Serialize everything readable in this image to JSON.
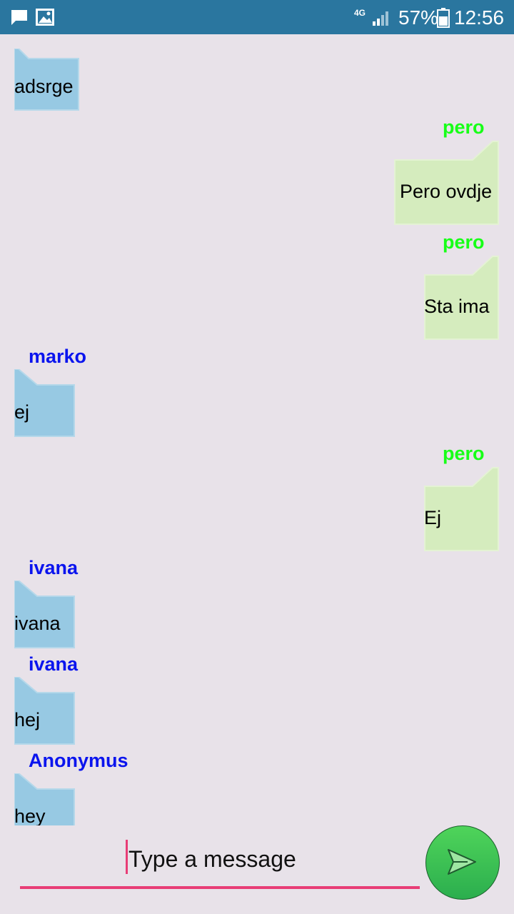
{
  "status_bar": {
    "network": "4G",
    "battery_percent": "57%",
    "time": "12:56",
    "icons": [
      "chat-icon",
      "image-icon",
      "signal-icon",
      "battery-icon"
    ]
  },
  "messages": [
    {
      "sender": "",
      "text": "adsrge",
      "side": "left"
    },
    {
      "sender": "pero",
      "text": "Pero ovdje",
      "side": "right"
    },
    {
      "sender": "pero",
      "text": "Sta ima",
      "side": "right"
    },
    {
      "sender": "marko",
      "text": "ej",
      "side": "left"
    },
    {
      "sender": "pero",
      "text": "Ej",
      "side": "right"
    },
    {
      "sender": "ivana",
      "text": "ivana",
      "side": "left"
    },
    {
      "sender": "ivana",
      "text": "hej",
      "side": "left"
    },
    {
      "sender": "Anonymus",
      "text": "hey",
      "side": "left"
    }
  ],
  "composer": {
    "placeholder": "Type a message",
    "value": "Type a message",
    "send_icon": "send-icon"
  },
  "colors": {
    "status_bar": "#2a769f",
    "background": "#e8e2e9",
    "incoming_bubble": "#97c9e3",
    "outgoing_bubble": "#d5ecbe",
    "other_sender": "#0a14ee",
    "self_sender": "#17ff17",
    "accent": "#e83d76",
    "send_button": "#3fc455"
  }
}
